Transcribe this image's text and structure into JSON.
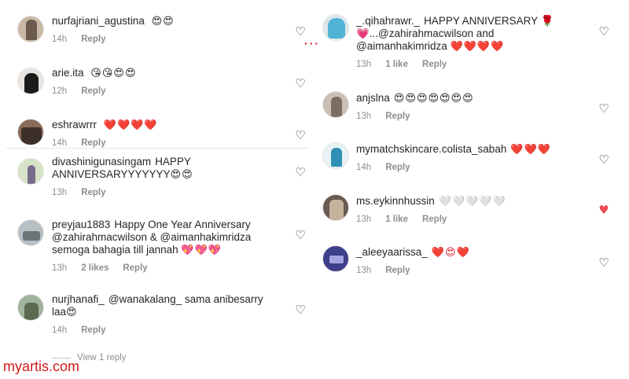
{
  "left_comments": [
    {
      "username": "nurfajriani_agustina",
      "text": "",
      "emoji": "😍😍",
      "emoji_color": "",
      "time": "14h",
      "likes": "",
      "reply": "Reply",
      "liked": false
    },
    {
      "username": "arie.ita",
      "text": "",
      "emoji": "😘😘😍😍",
      "emoji_color": "",
      "time": "12h",
      "likes": "",
      "reply": "Reply",
      "liked": false
    },
    {
      "username": "eshrawrrr",
      "text": "",
      "emoji": "❤️❤️❤️❤️",
      "emoji_color": "red",
      "time": "14h",
      "likes": "",
      "reply": "Reply",
      "liked": false
    },
    {
      "username": "divashinigunasingam",
      "text": "HAPPY ANNIVERSARYYYYYYY",
      "emoji": "😍😍",
      "emoji_color": "",
      "time": "13h",
      "likes": "",
      "reply": "Reply",
      "liked": false
    },
    {
      "username": "preyjau1883",
      "text": "Happy One Year Anniversary @zahirahmacwilson & @aimanhakimridza semoga bahagia till jannah",
      "emoji": "💖💖💖",
      "emoji_color": "pink",
      "time": "13h",
      "likes": "2 likes",
      "reply": "Reply",
      "liked": false
    },
    {
      "username": "nurjhanafi_",
      "text": "@wanakalang_  sama anibesarry laa",
      "emoji": "😍",
      "emoji_color": "",
      "time": "14h",
      "likes": "",
      "reply": "Reply",
      "liked": false
    }
  ],
  "view_replies": "View 1 reply",
  "right_comments": [
    {
      "username": "_.qihahrawr._",
      "text": "HAPPY ANNIVERSARY 🌹 💗...@zahirahmacwilson and @aimanhakimridza",
      "emoji": "❤️❤️❤️❤️",
      "emoji_color": "red",
      "time": "13h",
      "likes": "1 like",
      "reply": "Reply",
      "liked": false
    },
    {
      "username": "anjslna",
      "text": "",
      "emoji": "😍😍😍😍😍😍😍",
      "emoji_color": "",
      "time": "13h",
      "likes": "",
      "reply": "Reply",
      "liked": false
    },
    {
      "username": "mymatchskincare.colista_sabah",
      "text": "",
      "emoji": "❤️❤️❤️",
      "emoji_color": "red",
      "time": "14h",
      "likes": "",
      "reply": "Reply",
      "liked": false
    },
    {
      "username": "ms.eykinnhussin",
      "text": "",
      "emoji": "🤍🤍🤍🤍🤍",
      "emoji_color": "grey",
      "time": "13h",
      "likes": "1 like",
      "reply": "Reply",
      "liked": true
    },
    {
      "username": "_aleeyaarissa_",
      "text": "",
      "emoji": "❤️😍❤️",
      "emoji_color": "red",
      "time": "13h",
      "likes": "",
      "reply": "Reply",
      "liked": false
    }
  ],
  "icons": {
    "like": "heart-outline-icon",
    "liked": "heart-filled-icon"
  },
  "colors": {
    "liked_heart": "#ed4956",
    "meta_text": "#8e8e8e",
    "watermark": "#d31a1a"
  },
  "watermark": "myartis.com"
}
